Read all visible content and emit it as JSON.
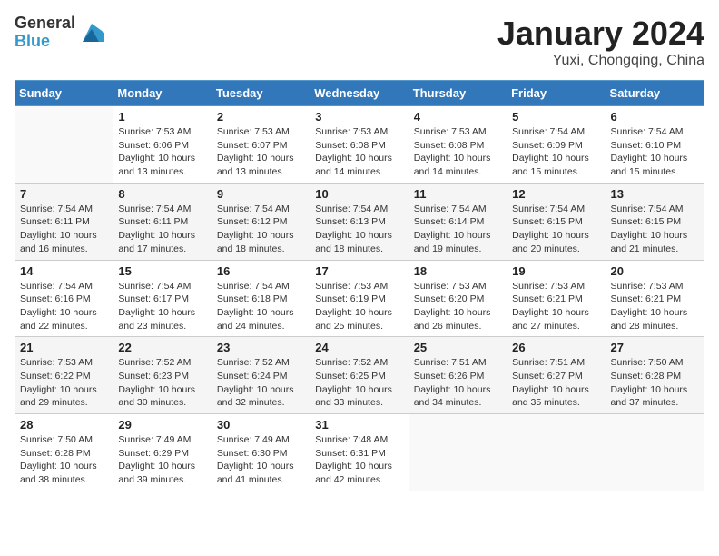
{
  "logo": {
    "general": "General",
    "blue": "Blue"
  },
  "header": {
    "month": "January 2024",
    "location": "Yuxi, Chongqing, China"
  },
  "weekdays": [
    "Sunday",
    "Monday",
    "Tuesday",
    "Wednesday",
    "Thursday",
    "Friday",
    "Saturday"
  ],
  "weeks": [
    [
      {
        "day": "",
        "info": ""
      },
      {
        "day": "1",
        "info": "Sunrise: 7:53 AM\nSunset: 6:06 PM\nDaylight: 10 hours\nand 13 minutes."
      },
      {
        "day": "2",
        "info": "Sunrise: 7:53 AM\nSunset: 6:07 PM\nDaylight: 10 hours\nand 13 minutes."
      },
      {
        "day": "3",
        "info": "Sunrise: 7:53 AM\nSunset: 6:08 PM\nDaylight: 10 hours\nand 14 minutes."
      },
      {
        "day": "4",
        "info": "Sunrise: 7:53 AM\nSunset: 6:08 PM\nDaylight: 10 hours\nand 14 minutes."
      },
      {
        "day": "5",
        "info": "Sunrise: 7:54 AM\nSunset: 6:09 PM\nDaylight: 10 hours\nand 15 minutes."
      },
      {
        "day": "6",
        "info": "Sunrise: 7:54 AM\nSunset: 6:10 PM\nDaylight: 10 hours\nand 15 minutes."
      }
    ],
    [
      {
        "day": "7",
        "info": "Sunrise: 7:54 AM\nSunset: 6:11 PM\nDaylight: 10 hours\nand 16 minutes."
      },
      {
        "day": "8",
        "info": "Sunrise: 7:54 AM\nSunset: 6:11 PM\nDaylight: 10 hours\nand 17 minutes."
      },
      {
        "day": "9",
        "info": "Sunrise: 7:54 AM\nSunset: 6:12 PM\nDaylight: 10 hours\nand 18 minutes."
      },
      {
        "day": "10",
        "info": "Sunrise: 7:54 AM\nSunset: 6:13 PM\nDaylight: 10 hours\nand 18 minutes."
      },
      {
        "day": "11",
        "info": "Sunrise: 7:54 AM\nSunset: 6:14 PM\nDaylight: 10 hours\nand 19 minutes."
      },
      {
        "day": "12",
        "info": "Sunrise: 7:54 AM\nSunset: 6:15 PM\nDaylight: 10 hours\nand 20 minutes."
      },
      {
        "day": "13",
        "info": "Sunrise: 7:54 AM\nSunset: 6:15 PM\nDaylight: 10 hours\nand 21 minutes."
      }
    ],
    [
      {
        "day": "14",
        "info": "Sunrise: 7:54 AM\nSunset: 6:16 PM\nDaylight: 10 hours\nand 22 minutes."
      },
      {
        "day": "15",
        "info": "Sunrise: 7:54 AM\nSunset: 6:17 PM\nDaylight: 10 hours\nand 23 minutes."
      },
      {
        "day": "16",
        "info": "Sunrise: 7:54 AM\nSunset: 6:18 PM\nDaylight: 10 hours\nand 24 minutes."
      },
      {
        "day": "17",
        "info": "Sunrise: 7:53 AM\nSunset: 6:19 PM\nDaylight: 10 hours\nand 25 minutes."
      },
      {
        "day": "18",
        "info": "Sunrise: 7:53 AM\nSunset: 6:20 PM\nDaylight: 10 hours\nand 26 minutes."
      },
      {
        "day": "19",
        "info": "Sunrise: 7:53 AM\nSunset: 6:21 PM\nDaylight: 10 hours\nand 27 minutes."
      },
      {
        "day": "20",
        "info": "Sunrise: 7:53 AM\nSunset: 6:21 PM\nDaylight: 10 hours\nand 28 minutes."
      }
    ],
    [
      {
        "day": "21",
        "info": "Sunrise: 7:53 AM\nSunset: 6:22 PM\nDaylight: 10 hours\nand 29 minutes."
      },
      {
        "day": "22",
        "info": "Sunrise: 7:52 AM\nSunset: 6:23 PM\nDaylight: 10 hours\nand 30 minutes."
      },
      {
        "day": "23",
        "info": "Sunrise: 7:52 AM\nSunset: 6:24 PM\nDaylight: 10 hours\nand 32 minutes."
      },
      {
        "day": "24",
        "info": "Sunrise: 7:52 AM\nSunset: 6:25 PM\nDaylight: 10 hours\nand 33 minutes."
      },
      {
        "day": "25",
        "info": "Sunrise: 7:51 AM\nSunset: 6:26 PM\nDaylight: 10 hours\nand 34 minutes."
      },
      {
        "day": "26",
        "info": "Sunrise: 7:51 AM\nSunset: 6:27 PM\nDaylight: 10 hours\nand 35 minutes."
      },
      {
        "day": "27",
        "info": "Sunrise: 7:50 AM\nSunset: 6:28 PM\nDaylight: 10 hours\nand 37 minutes."
      }
    ],
    [
      {
        "day": "28",
        "info": "Sunrise: 7:50 AM\nSunset: 6:28 PM\nDaylight: 10 hours\nand 38 minutes."
      },
      {
        "day": "29",
        "info": "Sunrise: 7:49 AM\nSunset: 6:29 PM\nDaylight: 10 hours\nand 39 minutes."
      },
      {
        "day": "30",
        "info": "Sunrise: 7:49 AM\nSunset: 6:30 PM\nDaylight: 10 hours\nand 41 minutes."
      },
      {
        "day": "31",
        "info": "Sunrise: 7:48 AM\nSunset: 6:31 PM\nDaylight: 10 hours\nand 42 minutes."
      },
      {
        "day": "",
        "info": ""
      },
      {
        "day": "",
        "info": ""
      },
      {
        "day": "",
        "info": ""
      }
    ]
  ]
}
